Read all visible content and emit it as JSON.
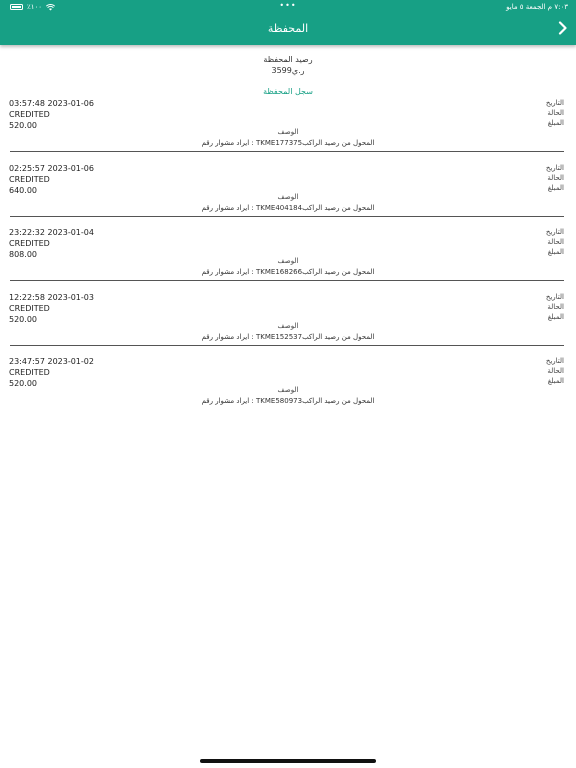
{
  "status_bar": {
    "time_date": "٧:٠٣ م   الجمعة ٥ مايو",
    "battery": "٪١٠٠",
    "dots": "•••"
  },
  "header": {
    "title": "المحفظة",
    "back_icon": "chevron-right-icon",
    "color": "#17a085"
  },
  "wallet": {
    "balance_label": "رصيد المحفظة",
    "balance_value": "3599ر.ي",
    "history_title": "سجل المحفظة"
  },
  "labels": {
    "date": "التاريخ",
    "status": "الحالة",
    "amount": "المبلغ",
    "description": "الوصف"
  },
  "transactions": [
    {
      "date": "03:57:48 2023-01-06",
      "status": "CREDITED",
      "amount": "520.00",
      "description": "ايراد مشوار رقم  : TKME177375المحول من رصيد الراكب"
    },
    {
      "date": "02:25:57 2023-01-06",
      "status": "CREDITED",
      "amount": "640.00",
      "description": "ايراد مشوار رقم  : TKME404184المحول من رصيد الراكب"
    },
    {
      "date": "23:22:32 2023-01-04",
      "status": "CREDITED",
      "amount": "808.00",
      "description": "ايراد مشوار رقم  : TKME168266المحول من رصيد الراكب"
    },
    {
      "date": "12:22:58 2023-01-03",
      "status": "CREDITED",
      "amount": "520.00",
      "description": "ايراد مشوار رقم  : TKME152537المحول من رصيد الراكب"
    },
    {
      "date": "23:47:57 2023-01-02",
      "status": "CREDITED",
      "amount": "520.00",
      "description": "ايراد مشوار رقم  : TKME580973المحول من رصيد الراكب"
    }
  ]
}
